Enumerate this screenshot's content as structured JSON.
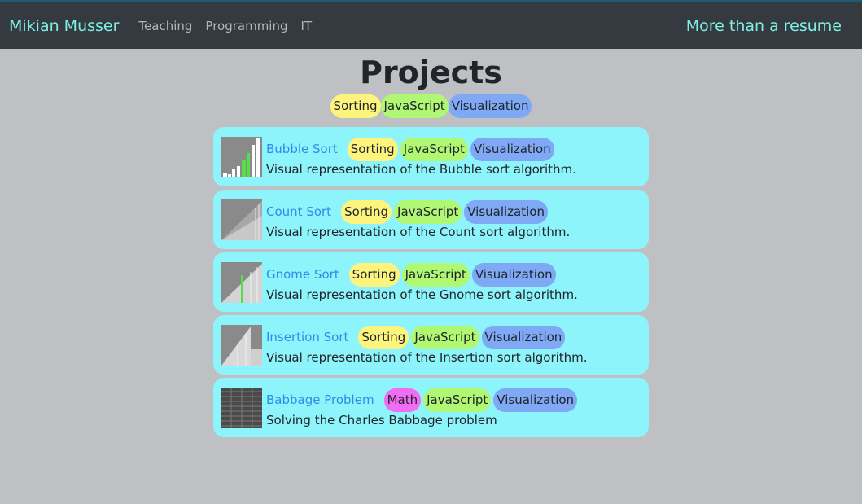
{
  "nav": {
    "brand": "Mikian Musser",
    "links": [
      "Teaching",
      "Programming",
      "IT"
    ],
    "right": "More than a resume"
  },
  "page_title": "Projects",
  "filters": [
    "Sorting",
    "JavaScript",
    "Visualization"
  ],
  "projects": [
    {
      "title": "Bubble Sort",
      "tags": [
        "Sorting",
        "JavaScript",
        "Visualization"
      ],
      "description": "Visual representation of the Bubble sort algorithm."
    },
    {
      "title": "Count Sort",
      "tags": [
        "Sorting",
        "JavaScript",
        "Visualization"
      ],
      "description": "Visual representation of the Count sort algorithm."
    },
    {
      "title": "Gnome Sort",
      "tags": [
        "Sorting",
        "JavaScript",
        "Visualization"
      ],
      "description": "Visual representation of the Gnome sort algorithm."
    },
    {
      "title": "Insertion Sort",
      "tags": [
        "Sorting",
        "JavaScript",
        "Visualization"
      ],
      "description": "Visual representation of the Insertion sort algorithm."
    },
    {
      "title": "Babbage Problem",
      "tags": [
        "Math",
        "JavaScript",
        "Visualization"
      ],
      "description": "Solving the Charles Babbage problem"
    }
  ],
  "colors": {
    "sorting": "#fcf47c",
    "javascript": "#b0f773",
    "visualization": "#7fa8f5",
    "math": "#f06cf3",
    "card": "#8df4fc"
  }
}
